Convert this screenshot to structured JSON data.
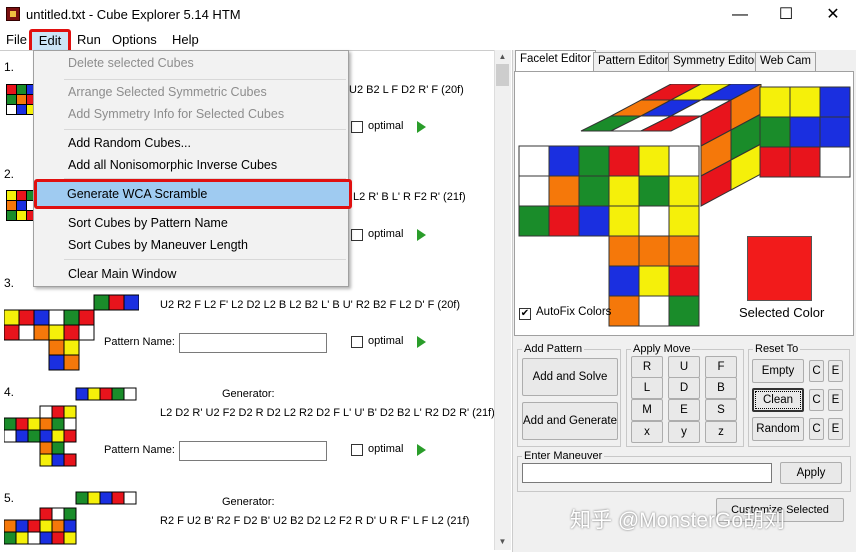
{
  "window": {
    "title": "untitled.txt - Cube Explorer 5.14 HTM",
    "controls": [
      "—",
      "☐",
      "✕"
    ]
  },
  "menubar": {
    "file": "File",
    "edit": "Edit",
    "run": "Run",
    "options": "Options",
    "help": "Help"
  },
  "edit_menu": {
    "items": [
      "Delete selected Cubes",
      "Arrange Selected Symmetric Cubes",
      "Add Symmetry Info for Selected Cubes",
      "Add Random Cubes...",
      "Add all Nonisomorphic Inverse Cubes",
      "Generate WCA Scramble",
      "Sort Cubes by Pattern Name",
      "Sort Cubes by Maneuver Length",
      "Clear Main Window"
    ],
    "highlighted": "Generate WCA Scramble"
  },
  "entries": [
    {
      "num": "1.",
      "gen_tail": "U2 B2 L F D2 R' F  (20f)",
      "optimal": "optimal"
    },
    {
      "num": "2.",
      "gen_tail": "L2 R' B L' R F2 R'  (21f)",
      "optimal": "optimal"
    },
    {
      "num": "3.",
      "gen_label": "Generator:",
      "gen": "U2 R2 F L2 F' L2 D2 L2 B L2 B2 L' B U' R2 B2 F L2 D' F  (20f)",
      "pattern_label": "Pattern Name:",
      "optimal": "optimal"
    },
    {
      "num": "4.",
      "gen_label": "Generator:",
      "gen": "L2 D2 R' U2 F2 D2 R D2 L2 R2 D2 F L' U' B' D2 B2 L' R2 D2 R'  (21f)",
      "pattern_label": "Pattern Name:",
      "optimal": "optimal"
    },
    {
      "num": "5.",
      "gen_label": "Generator:",
      "gen": "R2 F U2 B' R2 F D2 B' U2 B2 D2 L2 F2 R D' U R F' L F L2  (21f)"
    }
  ],
  "tabs": [
    "Facelet Editor",
    "Pattern Editor",
    "Symmetry Editor",
    "Web Cam"
  ],
  "facelet": {
    "autofix_label": "AutoFix Colors",
    "selected_color_label": "Selected Color",
    "selected_color": "#f21b1b"
  },
  "add_pattern": {
    "title": "Add Pattern",
    "add_and_solve": "Add and Solve",
    "add_and_generate": "Add and Generate"
  },
  "apply_move": {
    "title": "Apply Move",
    "buttons": [
      "R",
      "U",
      "F",
      "L",
      "D",
      "B",
      "M",
      "E",
      "S",
      "x",
      "y",
      "z"
    ]
  },
  "reset_to": {
    "title": "Reset To",
    "empty": "Empty",
    "clean": "Clean",
    "random": "Random",
    "c": "C",
    "e": "E"
  },
  "maneuver": {
    "title": "Enter Maneuver",
    "apply": "Apply",
    "customize": "Customize Selected Color"
  },
  "watermark": "知乎 @MonsterGo胡刘",
  "colors": {
    "red": "#e8141c",
    "blue": "#1a2fe0",
    "green": "#1a8c2a",
    "yellow": "#f5f00a",
    "orange": "#f5780a",
    "white": "#ffffff",
    "highlight": "#9fcbf1",
    "accent_red": "#e01010"
  }
}
